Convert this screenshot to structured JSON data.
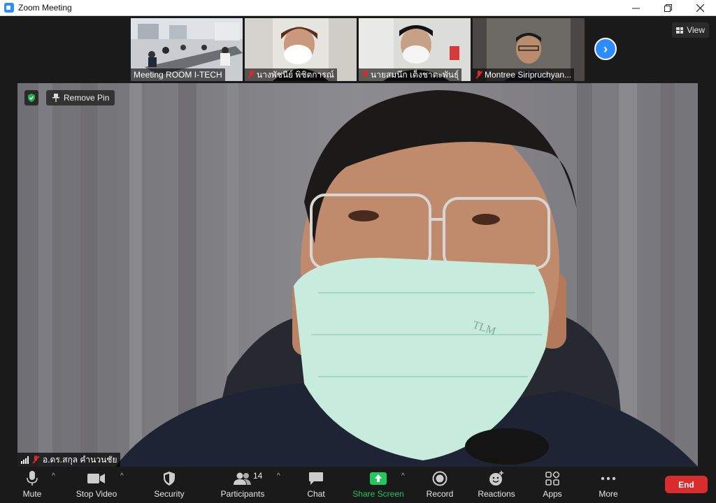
{
  "window": {
    "title": "Zoom Meeting",
    "controls": [
      "minimize",
      "maximize",
      "close"
    ]
  },
  "thumbnails": [
    {
      "name": "Meeting ROOM I-TECH",
      "muted": false
    },
    {
      "name": "นางพัชนีย์  พิชิตการณ์",
      "muted": true
    },
    {
      "name": "นายสมนึก  เต็งชาตะพันธุ์",
      "muted": true
    },
    {
      "name": "Montree Siripruchyan...",
      "muted": true
    }
  ],
  "view_button": {
    "label": "View"
  },
  "main_video": {
    "remove_pin_label": "Remove Pin",
    "speaker_name": "อ.ดร.สกุล  คำนวนชัย",
    "mask_text": "TLM"
  },
  "toolbar": {
    "mute": "Mute",
    "stop_video": "Stop Video",
    "security": "Security",
    "participants": "Participants",
    "participants_count": "14",
    "chat": "Chat",
    "share_screen": "Share Screen",
    "record": "Record",
    "reactions": "Reactions",
    "apps": "Apps",
    "more": "More",
    "end": "End"
  },
  "colors": {
    "accent": "#2d8cff",
    "share_green": "#22c55e",
    "end_red": "#d92c2c",
    "muted_red": "#e02828",
    "secure_green": "#22b14c"
  }
}
